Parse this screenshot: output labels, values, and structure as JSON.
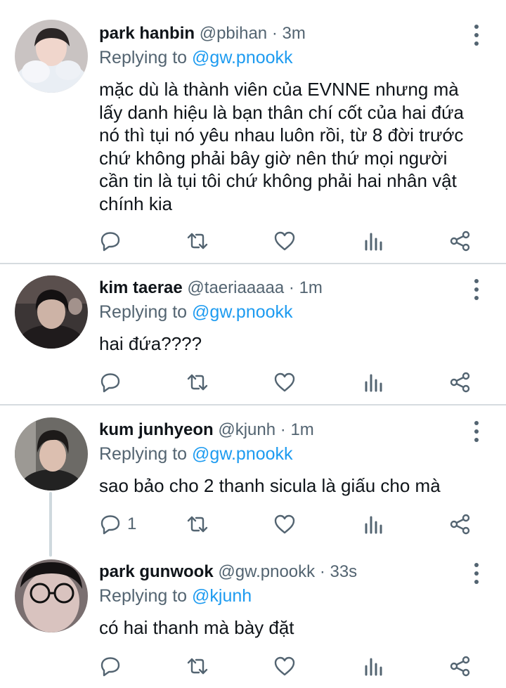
{
  "tweets": [
    {
      "name": "park hanbin",
      "handle": "@pbihan",
      "dot": "·",
      "time": "3m",
      "reply_prefix": "Replying to ",
      "reply_to": "@gw.pnookk",
      "text_lines": [
        "mặc dù là thành viên của EVNNE nhưng mà",
        "lấy danh hiệu là bạn thân chí cốt của hai đứa",
        "nó thì tụi nó yêu nhau luôn rồi, từ 8 đời trước",
        "chứ không phải bây giờ nên thứ mọi người",
        "cần tin là tụi tôi chứ không phải hai nhân vật",
        "chính kia"
      ],
      "reply_count": ""
    },
    {
      "name": "kim taerae",
      "handle": "@taeriaaaaa",
      "dot": "·",
      "time": "1m",
      "reply_prefix": "Replying to ",
      "reply_to": "@gw.pnookk",
      "text_lines": [
        "hai đứa????"
      ],
      "reply_count": ""
    },
    {
      "name": "kum junhyeon",
      "handle": "@kjunh",
      "dot": "·",
      "time": "1m",
      "reply_prefix": "Replying to ",
      "reply_to": "@gw.pnookk",
      "text_lines": [
        "sao bảo cho 2 thanh sicula là giấu cho mà"
      ],
      "reply_count": "1"
    },
    {
      "name": "park gunwook",
      "handle": "@gw.pnookk",
      "dot": "·",
      "time": "33s",
      "reply_prefix": "Replying to ",
      "reply_to": "@kjunh",
      "text_lines": [
        "có hai thanh mà bày đặt"
      ],
      "reply_count": ""
    }
  ],
  "icons": {
    "reply": "reply-icon",
    "retweet": "retweet-icon",
    "like": "heart-icon",
    "analytics": "analytics-icon",
    "share": "share-icon",
    "more": "more-vertical-icon"
  },
  "colors": {
    "text": "#0f1419",
    "secondary": "#536471",
    "link": "#1d9bf0",
    "divider": "#d6dbdf"
  }
}
